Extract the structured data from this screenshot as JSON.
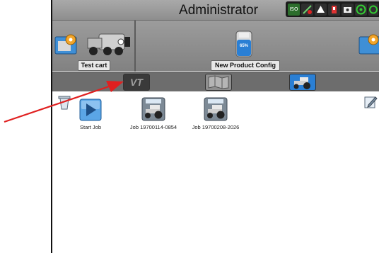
{
  "header": {
    "title": "Administrator"
  },
  "status_icons": [
    "iso-icon",
    "guidance-icon",
    "alert-icon",
    "warning-icon",
    "camera-icon",
    "gps-icon",
    "network-icon"
  ],
  "status_text": {
    "iso": "ISO"
  },
  "config": {
    "cart_label": "Test cart",
    "product_label": "New Product Config",
    "tank_level": "65%"
  },
  "tabs": [
    "vt-tab",
    "map-tab",
    "tractor-tab"
  ],
  "jobs": [
    {
      "label": "Start Job"
    },
    {
      "label": "Job 19700114-0854"
    },
    {
      "label": "Job 19700208-2026"
    }
  ],
  "colors": {
    "accent_blue": "#2a7fd4",
    "titlebar": "#9a9a9a",
    "arrow": "#e02020"
  }
}
